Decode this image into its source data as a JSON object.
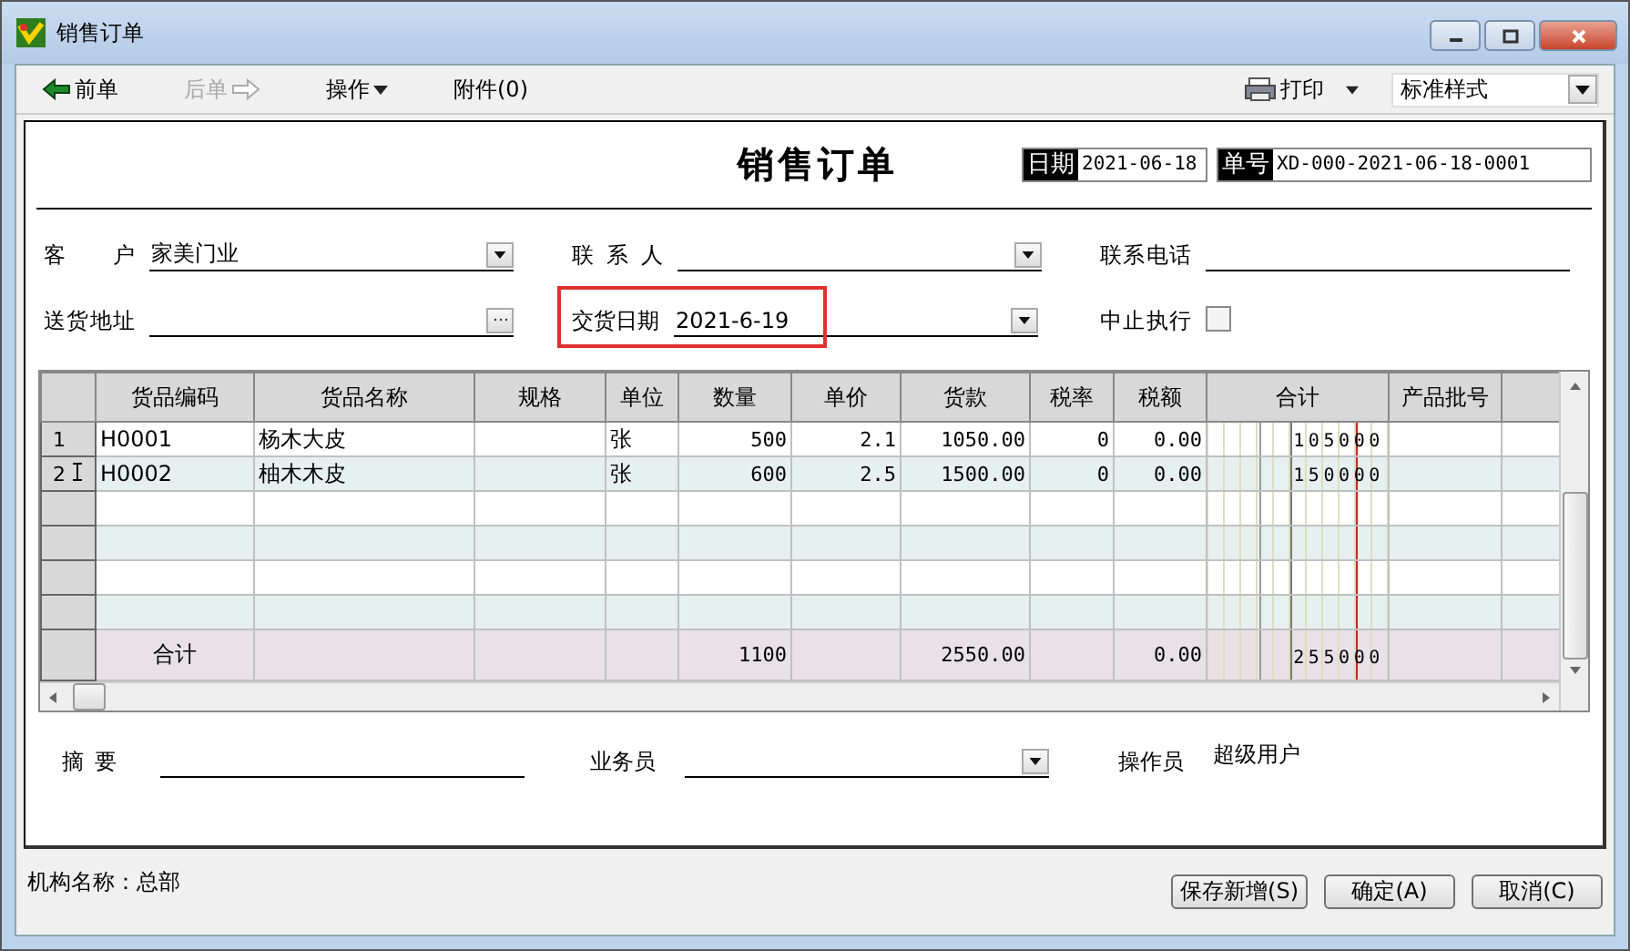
{
  "window": {
    "title": "销售订单"
  },
  "toolbar": {
    "items": [
      {
        "kind": "prev",
        "label": "前单",
        "disabled": false
      },
      {
        "kind": "next",
        "label": "后单",
        "disabled": true
      },
      {
        "kind": "menu",
        "label": "操作",
        "disabled": false
      },
      {
        "kind": "plain",
        "label": "附件(0)",
        "disabled": false
      }
    ],
    "print": "打印",
    "style_select": "标准样式"
  },
  "form": {
    "title": "销售订单",
    "date_label": "日期",
    "date": "2021-06-18",
    "number_label": "单号",
    "number": "XD-000-2021-06-18-0001",
    "fields": [
      {
        "kind": "dropdown",
        "label": "客 户",
        "value": "家美门业",
        "highlighted": false
      },
      {
        "kind": "dropdown",
        "label": "联 系 人",
        "highlighted": false
      },
      {
        "kind": "text",
        "label": "联系电话",
        "highlighted": false
      },
      {
        "kind": "browse",
        "label": "送货地址",
        "highlighted": false
      },
      {
        "kind": "dropdown",
        "label": "交货日期",
        "value": "2021-6-19",
        "highlighted": true
      },
      {
        "kind": "checkbox",
        "label": "中止执行",
        "checked": false,
        "highlighted": false
      }
    ]
  },
  "table": {
    "columns": [
      "货品编码",
      "货品名称",
      "规格",
      "单位",
      "数量",
      "单价",
      "货款",
      "税率",
      "税额",
      "合计",
      "产品批号"
    ],
    "rows": [
      {
        "num": "1",
        "code": "H0001",
        "name": "杨木大皮",
        "unit": "张",
        "qty": "500",
        "price": "2.1",
        "amount": "1050.00",
        "tax_rate": "0",
        "tax": "0.00",
        "total": "105000",
        "editing": false
      },
      {
        "num": "2",
        "code": "H0002",
        "name": "柚木木皮",
        "unit": "张",
        "qty": "600",
        "price": "2.5",
        "amount": "1500.00",
        "tax_rate": "0",
        "tax": "0.00",
        "total": "150000",
        "editing": true
      }
    ],
    "totals": {
      "label": "合计",
      "qty": "1100",
      "amount": "2550.00",
      "tax": "0.00",
      "total": "255000"
    }
  },
  "footer": {
    "fields": [
      {
        "kind": "text",
        "label": "摘 要"
      },
      {
        "kind": "dropdown",
        "label": "业务员"
      },
      {
        "kind": "static",
        "label": "操作员",
        "value": "超级用户"
      }
    ]
  },
  "status_bar": {
    "org": "机构名称：总部",
    "buttons": [
      "保存新增(S)",
      "确定(A)",
      "取消(C)"
    ]
  }
}
